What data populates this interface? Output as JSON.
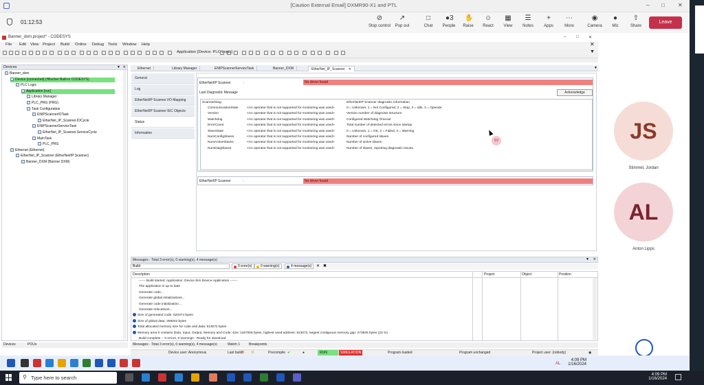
{
  "teams": {
    "window_title": "[Caution External Email] DXMR90-X1 and PTL",
    "timer": "01:12:53",
    "toolbar": [
      {
        "label": "Stop control",
        "icon": "stop-control-icon"
      },
      {
        "label": "Pop out",
        "icon": "pop-out-icon"
      },
      {
        "label": "Chat",
        "icon": "chat-icon"
      },
      {
        "label": "People",
        "icon": "people-icon",
        "count": "3"
      },
      {
        "label": "Raise",
        "icon": "hand-icon"
      },
      {
        "label": "React",
        "icon": "smiley-icon"
      },
      {
        "label": "View",
        "icon": "grid-icon"
      },
      {
        "label": "Notes",
        "icon": "notes-icon"
      },
      {
        "label": "Apps",
        "icon": "apps-icon"
      },
      {
        "label": "More",
        "icon": "more-icon"
      },
      {
        "label": "Camera",
        "icon": "camera-icon"
      },
      {
        "label": "Mic",
        "icon": "mic-icon"
      },
      {
        "label": "Share",
        "icon": "share-icon"
      }
    ],
    "leave_label": "Leave",
    "participants": [
      {
        "initials": "JS",
        "name": "Stimmel, Jordan",
        "bg": "#f6dcd6",
        "fg": "#8a3a2a"
      },
      {
        "initials": "AL",
        "name": "Anton Lipps",
        "bg": "#f3d3d6",
        "fg": "#7a2230"
      }
    ],
    "sv_badge": "SV"
  },
  "codesys": {
    "title": "Banner_dxm.project* - CODESYS",
    "menu": [
      "File",
      "Edit",
      "View",
      "Project",
      "Build",
      "Online",
      "Debug",
      "Tools",
      "Window",
      "Help"
    ],
    "app_selector": "Application [Device: PLC Logic]",
    "devices_title": "Devices",
    "tree": [
      {
        "label": "Banner_dxm",
        "indent": 0,
        "hl": false
      },
      {
        "label": "Device [connected] (Hilscher Built-in CODESYS)",
        "indent": 1,
        "hl": true
      },
      {
        "label": "PLC Logic",
        "indent": 2,
        "hl": false
      },
      {
        "label": "Application [run]",
        "indent": 3,
        "hl": true
      },
      {
        "label": "Library Manager",
        "indent": 4,
        "hl": false
      },
      {
        "label": "PLC_PRG (PRG)",
        "indent": 4,
        "hl": false
      },
      {
        "label": "Task Configuration",
        "indent": 4,
        "hl": false
      },
      {
        "label": "ENIPScannerIOTask",
        "indent": 5,
        "hl": false
      },
      {
        "label": "EtherNet_IP_Scanner.IOCycle",
        "indent": 6,
        "hl": false
      },
      {
        "label": "ENIPScannerServiceTask",
        "indent": 5,
        "hl": false
      },
      {
        "label": "EtherNet_IP_Scanner.ServiceCycle",
        "indent": 6,
        "hl": false
      },
      {
        "label": "MainTask",
        "indent": 5,
        "hl": false
      },
      {
        "label": "PLC_PRG",
        "indent": 6,
        "hl": false
      },
      {
        "label": "Ethernet (Ethernet)",
        "indent": 1,
        "hl": false
      },
      {
        "label": "EtherNet_IP_Scanner (EtherNet/IP Scanner)",
        "indent": 2,
        "hl": false
      },
      {
        "label": "Banner_DXM (Banner DXM)",
        "indent": 3,
        "hl": false
      }
    ],
    "editor_tabs": [
      "Ethernet",
      "Library Manager",
      "ENIPScannerServiceTask",
      "Banner_DXM",
      "EtherNet_IP_Scanner"
    ],
    "active_tab": "EtherNet_IP_Scanner",
    "nav_items": [
      "General",
      "Log",
      "EtherNet/IP Scanner I/O Mapping",
      "EtherNet/IP Scanner IEC Objects",
      "Status",
      "Information"
    ],
    "status": {
      "scanner_label": "EtherNet/IP Scanner",
      "scanner_value": "No driver found",
      "last_diag_label": "Last Diagnostic Message",
      "ack_label": "Acknowledge",
      "diag_header_name": "ScannerDiag",
      "diag_header_desc": "EtherNet/IP Scanner diagnostic information",
      "diag_rows": [
        {
          "name": "CommunicationState",
          "value": "<An operator that is not supported for monitoring was used>",
          "desc": "0 = Unknown, 1 = Not Configured, 2 = Stop, 3 = Idle, 4 = Operate"
        },
        {
          "name": "Version",
          "value": "<An operator that is not supported for monitoring was used>",
          "desc": "Version number of diagnosis structure"
        },
        {
          "name": "Watchdog",
          "value": "<An operator that is not supported for monitoring was used>",
          "desc": "Configured Watchdog Timeout"
        },
        {
          "name": "ErrorCount",
          "value": "<An operator that is not supported for monitoring was used>",
          "desc": "Total number of detected errors since startup"
        },
        {
          "name": "SlaveState",
          "value": "<An operator that is not supported for monitoring was used>",
          "desc": "0 = Unknown, 1 = OK, 2 = Failed, 3 = Warning"
        },
        {
          "name": "NumConfigSlaves",
          "value": "<An operator that is not supported for monitoring was used>",
          "desc": "Number of configured slaves"
        },
        {
          "name": "NumActiveSlaves",
          "value": "<An operator that is not supported for monitoring was used>",
          "desc": "Number of active slaves"
        },
        {
          "name": "NumDiagSlaves",
          "value": "<An operator that is not supported for monitoring was used>",
          "desc": "Number of slaves, reporting diagnostic issues."
        }
      ],
      "scanner2_label": "EtherNet/IP Scanner",
      "scanner2_value": "No driver found"
    },
    "messages": {
      "title": "Messages - Total 3 error(s), 0 warning(s), 4 message(s)",
      "filter": "Build",
      "errors": "0 error(s)",
      "warnings": "0 warning(s)",
      "msgs": "4 message(s)",
      "columns": [
        "Description",
        "Project",
        "Object",
        "Position"
      ],
      "rows": [
        {
          "text": "------ Build started: Application: Device.Sim.Device.Application -------",
          "info": false
        },
        {
          "text": "The application is up to date",
          "info": false
        },
        {
          "text": "Generate code...",
          "info": false
        },
        {
          "text": "Generate global initializations...",
          "info": false
        },
        {
          "text": "Generate code initialization...",
          "info": false
        },
        {
          "text": "Generate relocations...",
          "info": false
        },
        {
          "text": "Size of generated code: 620374 bytes",
          "info": true
        },
        {
          "text": "Size of global data: 258042 bytes",
          "info": true
        },
        {
          "text": "Total allocated memory size for code and data: 913072 bytes",
          "info": true
        },
        {
          "text": "Memory area 0 contains Data, Input, Output, Memory and Code: size: 1187008 bytes, highest used address: 913072, largest contiguous memory gap: 273936 bytes (23 %)",
          "info": true
        },
        {
          "text": "Build complete -- 0 errors, 0 warnings : Ready for download",
          "info": false
        }
      ]
    },
    "bottom_tabs_left": [
      "Devices",
      "POUs"
    ],
    "bottom_tabs_right": [
      "Messages - Total 3 error(s), 0 warning(s), 4 message(s)",
      "Watch 1",
      "Breakpoints"
    ],
    "statusbar": {
      "device_user": "Device user: Anonymous",
      "last_build": "Last build:",
      "errs": "0",
      "warns": "0",
      "precompile": "Precompile",
      "run": "RUN",
      "simulation": "SIMULATION",
      "program_loaded": "Program loaded",
      "program_unchanged": "Program unchanged",
      "project_user": "Project user: (nobody)"
    }
  },
  "taskbar_inner": {
    "time": "4:09 PM",
    "date": "1/16/2024",
    "user": "AL"
  },
  "taskbar_outer": {
    "search_placeholder": "Type here to search",
    "time": "4:09 PM",
    "date": "1/16/2024"
  }
}
